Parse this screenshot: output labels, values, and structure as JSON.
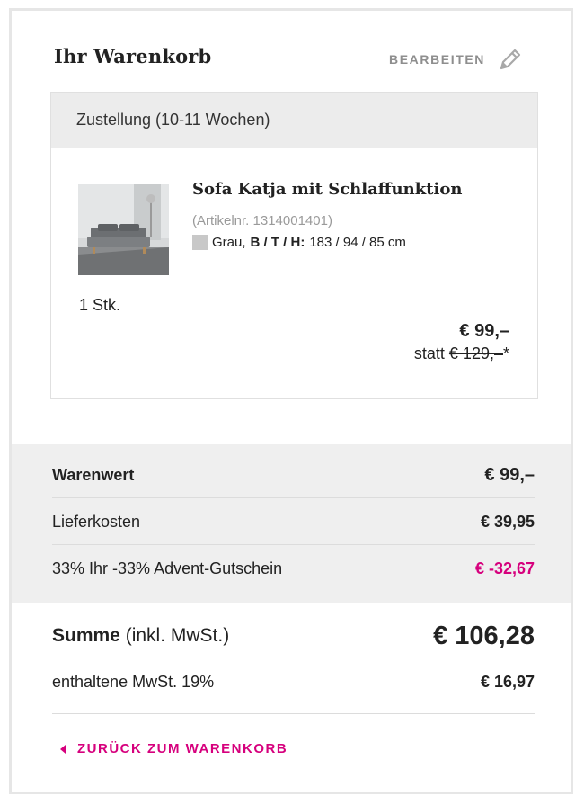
{
  "cart": {
    "title": "Ihr Warenkorb",
    "edit_label": "BEARBEITEN",
    "edit_icon": "pencil-icon"
  },
  "item": {
    "delivery": "Zustellung (10-11 Wochen)",
    "name": "Sofa Katja mit Schlaffunktion",
    "article_nr": "(Artikelnr. 1314001401)",
    "color": "Grau,",
    "dims_label": "B / T / H:",
    "dims_value": "183 / 94 / 85 cm",
    "quantity": "1 Stk.",
    "price": "€ 99,–",
    "old_prefix": "statt",
    "old_price": "€ 129,–",
    "old_suffix": "*",
    "swatch_color": "#c8c8c8"
  },
  "summary": {
    "goods_label": "Warenwert",
    "goods_value": "€ 99,–",
    "shipping_label": "Lieferkosten",
    "shipping_value": "€ 39,95",
    "voucher_label": "33% Ihr -33% Advent-Gutschein",
    "voucher_value": "€ -32,67"
  },
  "totals": {
    "sum_label": "Summe",
    "sum_note": "(inkl. MwSt.)",
    "sum_value": "€ 106,28",
    "vat_label": "enthaltene MwSt. 19%",
    "vat_value": "€ 16,97"
  },
  "footer": {
    "back_label": "ZURÜCK ZUM WARENKORB",
    "back_icon": "caret-left-icon"
  },
  "colors": {
    "accent": "#d6007d",
    "panel_bg": "#efefef",
    "muted": "#8e8e8e"
  }
}
